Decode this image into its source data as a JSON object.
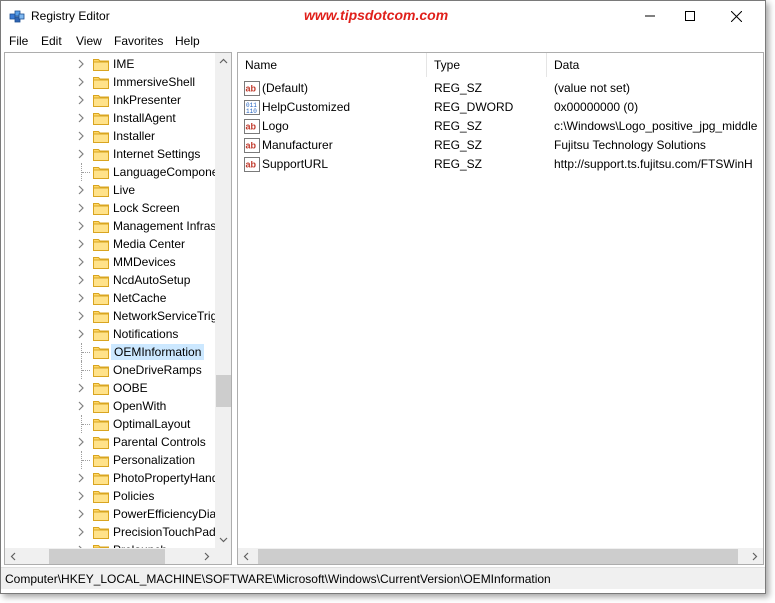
{
  "window": {
    "title": "Registry Editor",
    "watermark": "www.tipsdotcom.com",
    "watermark_color": "#e0201b"
  },
  "menu": [
    "File",
    "Edit",
    "View",
    "Favorites",
    "Help"
  ],
  "tree": {
    "items": [
      {
        "label": "IME",
        "expandable": true
      },
      {
        "label": "ImmersiveShell",
        "expandable": true
      },
      {
        "label": "InkPresenter",
        "expandable": true
      },
      {
        "label": "InstallAgent",
        "expandable": true
      },
      {
        "label": "Installer",
        "expandable": true
      },
      {
        "label": "Internet Settings",
        "expandable": true
      },
      {
        "label": "LanguageCompone",
        "expandable": false
      },
      {
        "label": "Live",
        "expandable": true
      },
      {
        "label": "Lock Screen",
        "expandable": true
      },
      {
        "label": "Management Infras",
        "expandable": true
      },
      {
        "label": "Media Center",
        "expandable": true
      },
      {
        "label": "MMDevices",
        "expandable": true
      },
      {
        "label": "NcdAutoSetup",
        "expandable": true
      },
      {
        "label": "NetCache",
        "expandable": true
      },
      {
        "label": "NetworkServiceTrig",
        "expandable": true
      },
      {
        "label": "Notifications",
        "expandable": true
      },
      {
        "label": "OEMInformation",
        "expandable": false,
        "selected": true
      },
      {
        "label": "OneDriveRamps",
        "expandable": false
      },
      {
        "label": "OOBE",
        "expandable": true
      },
      {
        "label": "OpenWith",
        "expandable": true
      },
      {
        "label": "OptimalLayout",
        "expandable": false
      },
      {
        "label": "Parental Controls",
        "expandable": true
      },
      {
        "label": "Personalization",
        "expandable": false
      },
      {
        "label": "PhotoPropertyHand",
        "expandable": true
      },
      {
        "label": "Policies",
        "expandable": true
      },
      {
        "label": "PowerEfficiencyDia",
        "expandable": true
      },
      {
        "label": "PrecisionTouchPad",
        "expandable": true
      },
      {
        "label": "Prelaunch",
        "expandable": true
      }
    ]
  },
  "list": {
    "columns": [
      "Name",
      "Type",
      "Data"
    ],
    "rows": [
      {
        "name": "(Default)",
        "type": "REG_SZ",
        "data": "(value not set)",
        "icon": "string-value-icon"
      },
      {
        "name": "HelpCustomized",
        "type": "REG_DWORD",
        "data": "0x00000000 (0)",
        "icon": "binary-value-icon"
      },
      {
        "name": "Logo",
        "type": "REG_SZ",
        "data": "c:\\Windows\\Logo_positive_jpg_middle",
        "icon": "string-value-icon"
      },
      {
        "name": "Manufacturer",
        "type": "REG_SZ",
        "data": "Fujitsu Technology Solutions",
        "icon": "string-value-icon"
      },
      {
        "name": "SupportURL",
        "type": "REG_SZ",
        "data": "http://support.ts.fujitsu.com/FTSWinH",
        "icon": "string-value-icon"
      }
    ]
  },
  "status": {
    "path": "Computer\\HKEY_LOCAL_MACHINE\\SOFTWARE\\Microsoft\\Windows\\CurrentVersion\\OEMInformation"
  }
}
